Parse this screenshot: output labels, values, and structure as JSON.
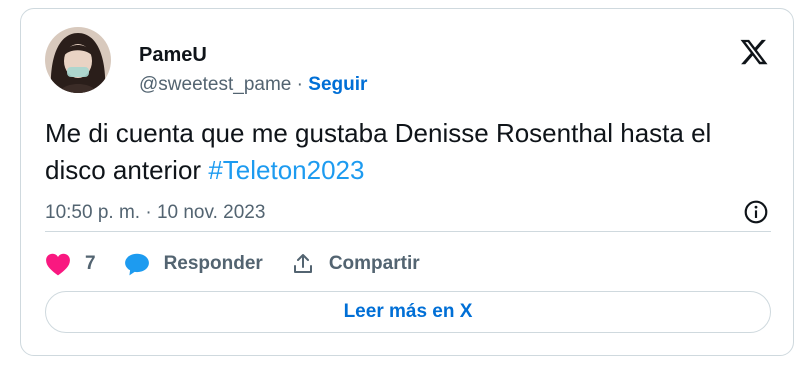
{
  "user": {
    "display_name": "PameU",
    "handle": "@sweetest_pame",
    "separator": "·",
    "follow_label": "Seguir"
  },
  "tweet": {
    "text": "Me di cuenta que me gustaba Denisse Rosenthal hasta el disco anterior ",
    "hashtag": "#Teleton2023",
    "time": "10:50 p. m.",
    "date_separator": "·",
    "date": "10 nov. 2023"
  },
  "actions": {
    "likes_count": "7",
    "reply_label": "Responder",
    "share_label": "Compartir"
  },
  "read_more_label": "Leer más en X",
  "colors": {
    "accent": "#1d9bf0",
    "link": "#006fd6",
    "heart": "#f91880",
    "text": "#0f1419",
    "secondary": "#536471",
    "border": "#cfd9de"
  },
  "icons": [
    "x-logo-icon",
    "info-icon",
    "heart-icon",
    "reply-bubble-icon",
    "share-icon"
  ]
}
